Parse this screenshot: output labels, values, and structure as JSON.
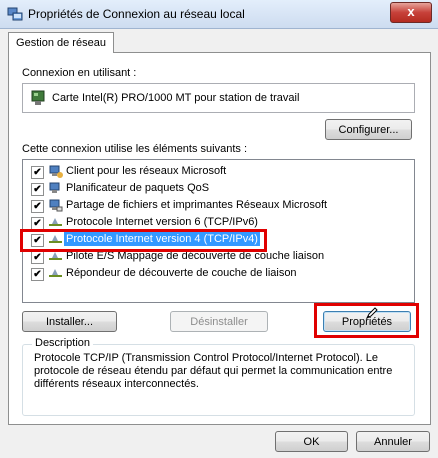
{
  "window": {
    "title": "Propriétés de Connexion au réseau local",
    "close_label": "x"
  },
  "tab": {
    "label": "Gestion de réseau"
  },
  "connection": {
    "label": "Connexion en utilisant :",
    "adapter": "Carte Intel(R) PRO/1000 MT pour station de travail",
    "configure_label": "Configurer..."
  },
  "elements": {
    "label": "Cette connexion utilise les éléments suivants :",
    "items": [
      {
        "label": "Client pour les réseaux Microsoft",
        "checked": true,
        "icon": "network-client-icon"
      },
      {
        "label": "Planificateur de paquets QoS",
        "checked": true,
        "icon": "qos-scheduler-icon"
      },
      {
        "label": "Partage de fichiers et imprimantes Réseaux Microsoft",
        "checked": true,
        "icon": "file-printer-sharing-icon"
      },
      {
        "label": "Protocole Internet version 6 (TCP/IPv6)",
        "checked": true,
        "icon": "protocol-icon"
      },
      {
        "label": "Protocole Internet version 4 (TCP/IPv4)",
        "checked": true,
        "icon": "protocol-icon",
        "selected": true
      },
      {
        "label": "Pilote E/S Mappage de découverte de couche liaison",
        "checked": true,
        "icon": "protocol-icon"
      },
      {
        "label": "Répondeur de découverte de couche de liaison",
        "checked": true,
        "icon": "protocol-icon"
      }
    ],
    "check_mark": "✔"
  },
  "buttons": {
    "install": "Installer...",
    "uninstall": "Désinstaller",
    "properties": "Propriétés",
    "ok": "OK",
    "cancel": "Annuler"
  },
  "description": {
    "title": "Description",
    "text": "Protocole TCP/IP (Transmission Control Protocol/Internet Protocol). Le protocole de réseau étendu par défaut qui permet la communication entre différents réseaux interconnectés."
  },
  "colors": {
    "highlight": "#e00000",
    "selection": "#3399ff"
  }
}
